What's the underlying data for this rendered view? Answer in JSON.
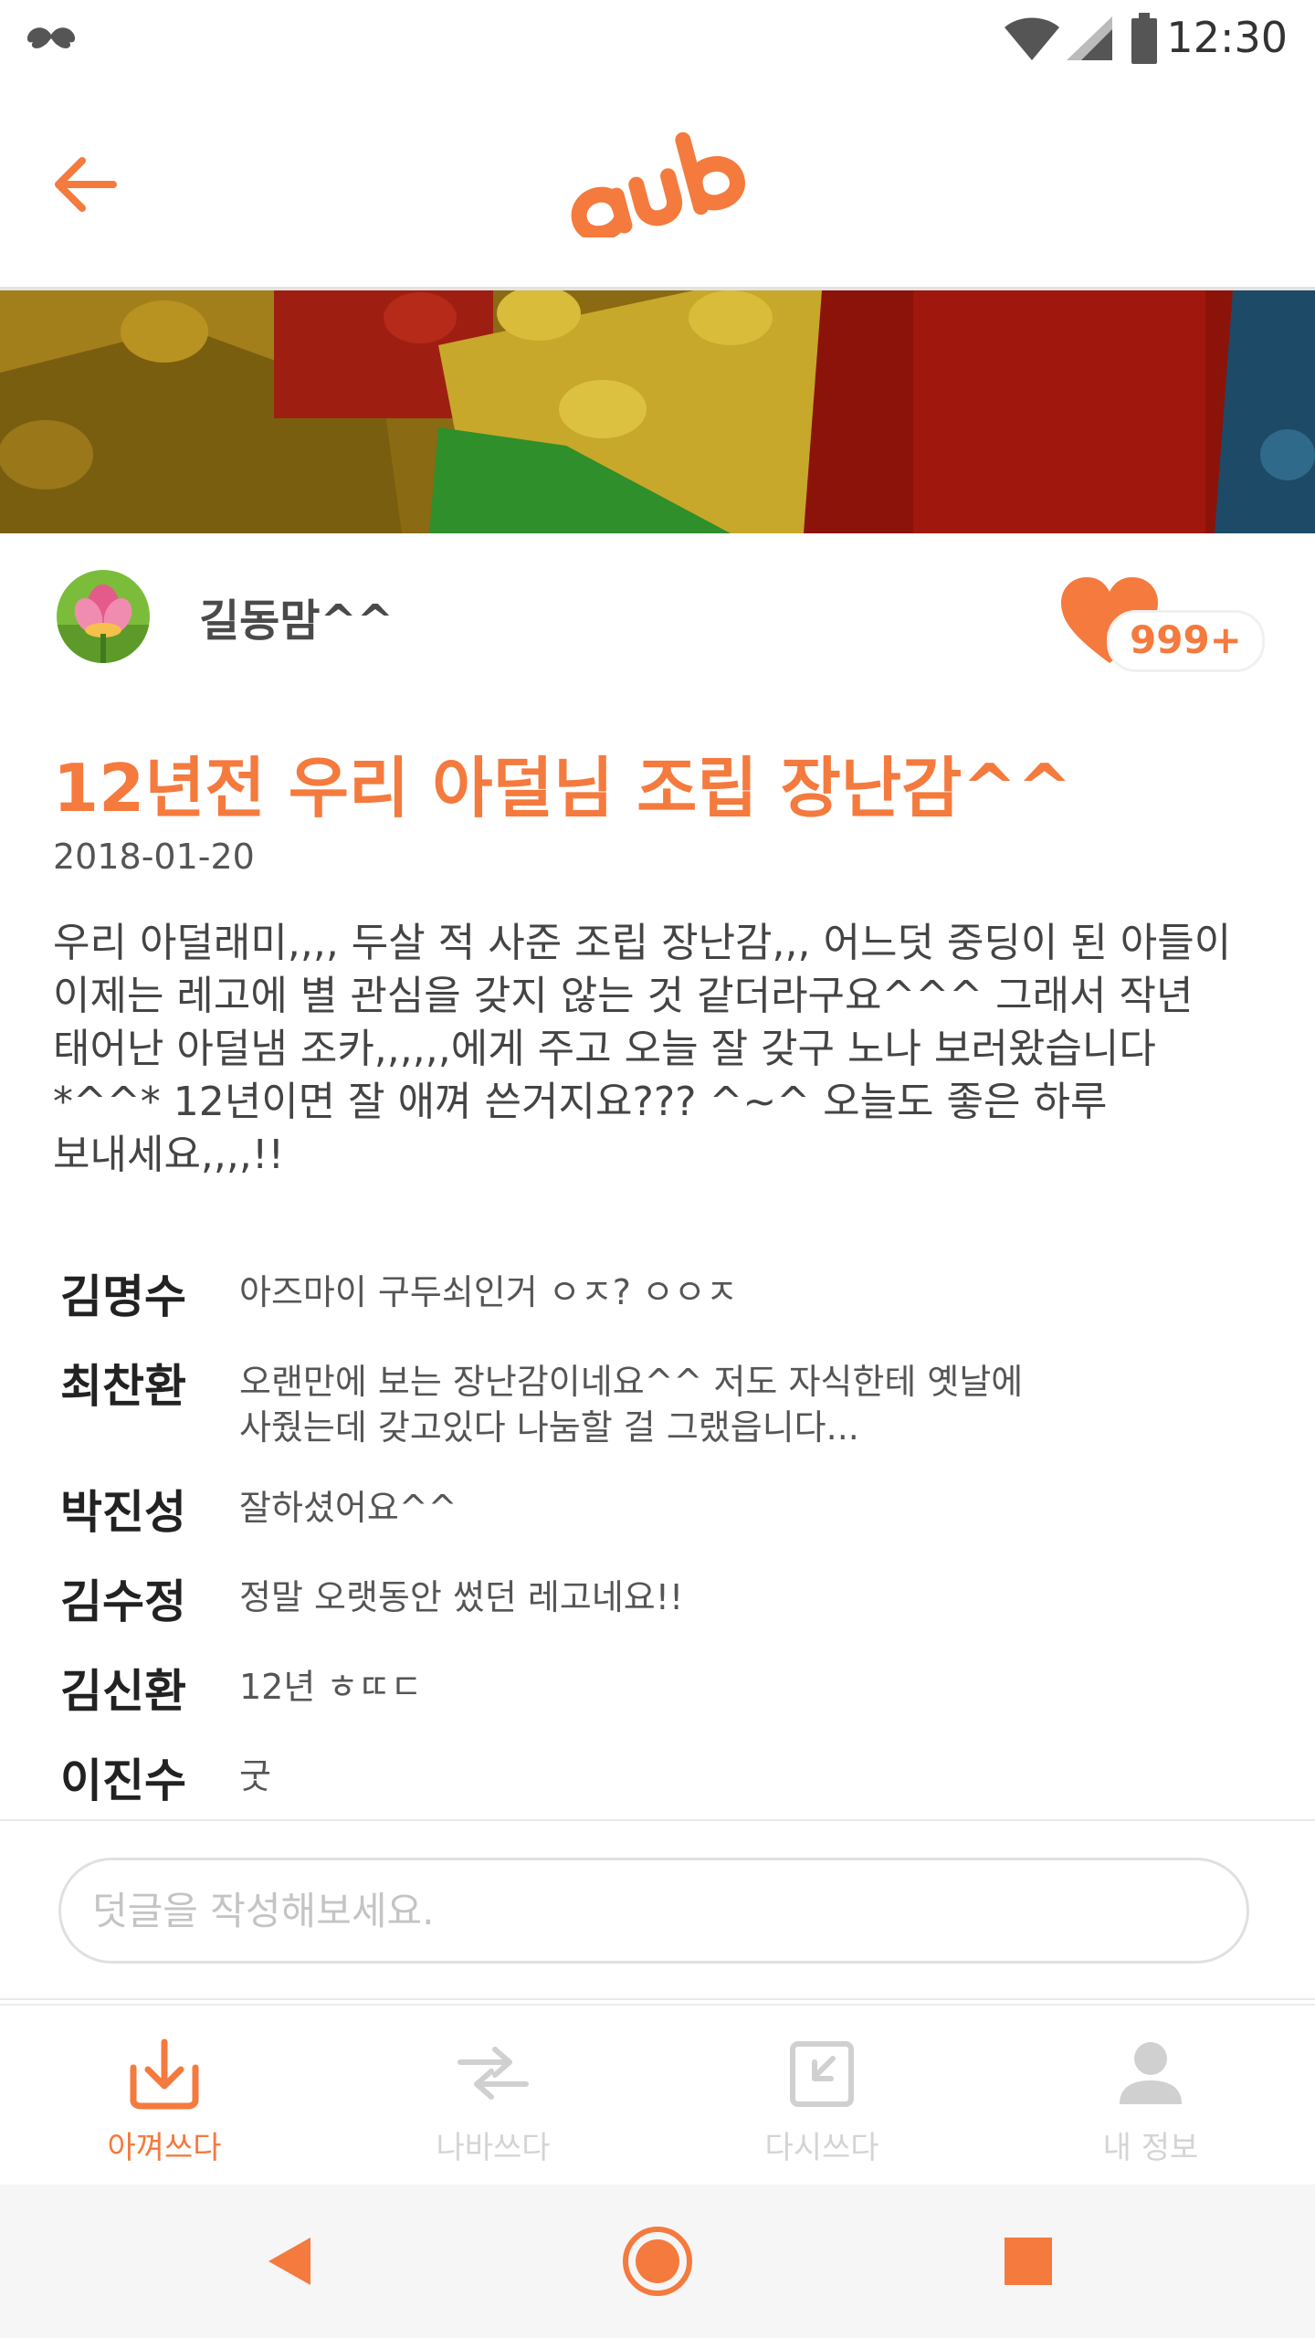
{
  "status_bar": {
    "time": "12:30"
  },
  "app_bar": {
    "logo_text": "aup"
  },
  "author": {
    "name": "길동맘^^"
  },
  "likes": {
    "count": "999+"
  },
  "post": {
    "title": "12년전 우리 아덜님 조립 장난감^^",
    "date": "2018-01-20",
    "body_lines": [
      "우리 아덜래미,,,, 두살 적 사준 조립 장난감,,, 어느덧 중딩이 된 아들이",
      "이제는 레고에 별 관심을 갖지 않는 것 같더라구요^^^ 그래서 작년",
      "태어난 아덜냄 조카,,,,,,에게 주고 오늘 잘 갖구 노나 보러왔습니다",
      "*^^* 12년이면 잘 애껴 쓴거지요???  ^~^ 오늘도 좋은 하루",
      "보내세요,,,,!!"
    ]
  },
  "comments": [
    {
      "name": "김명수",
      "text": [
        "아즈마이 구두쇠인거 ㅇㅈ? ㅇㅇㅈ"
      ]
    },
    {
      "name": "최찬환",
      "text": [
        "오랜만에 보는 장난감이네요^^ 저도 자식한테 옛날에",
        "사줬는데 갖고있다 나눔할 걸 그랬읍니다..."
      ]
    },
    {
      "name": "박진성",
      "text": [
        "잘하셨어요^^"
      ]
    },
    {
      "name": "김수정",
      "text": [
        "정말 오랫동안 썼던 레고네요!!"
      ]
    },
    {
      "name": "김신환",
      "text": [
        "12년 ㅎㄸㄷ"
      ]
    },
    {
      "name": "이진수",
      "text": [
        "굿"
      ]
    }
  ],
  "comment_input": {
    "placeholder": "덧글을 작성해보세요."
  },
  "tabs": [
    {
      "label": "아껴쓰다",
      "icon": "download-box-icon",
      "active": true
    },
    {
      "label": "나바쓰다",
      "icon": "exchange-arrows-icon",
      "active": false
    },
    {
      "label": "다시쓰다",
      "icon": "reuse-box-icon",
      "active": false
    },
    {
      "label": "내 정보",
      "icon": "person-icon",
      "active": false
    }
  ],
  "colors": {
    "accent": "#f47a3e",
    "inactive": "#d4d4d4"
  }
}
